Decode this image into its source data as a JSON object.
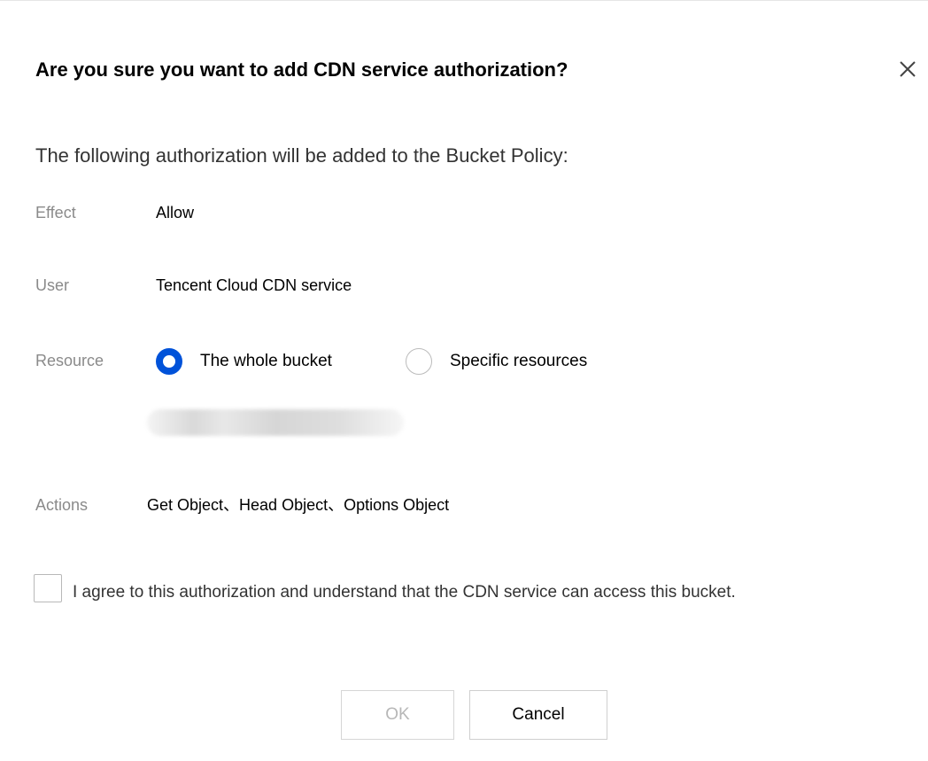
{
  "dialog": {
    "title": "Are you sure you want to add CDN service authorization?",
    "close_icon": "close-icon",
    "intro": "The following authorization will be added to the Bucket Policy:",
    "effect": {
      "label": "Effect",
      "value": "Allow"
    },
    "user": {
      "label": "User",
      "value": "Tencent Cloud CDN service"
    },
    "resource": {
      "label": "Resource",
      "options": [
        {
          "label": "The whole bucket",
          "selected": true
        },
        {
          "label": "Specific resources",
          "selected": false
        }
      ]
    },
    "actions": {
      "label": "Actions",
      "value": "Get Object、Head Object、Options Object"
    },
    "agreement": {
      "text": "I agree to this authorization and understand that the CDN service can access this bucket.",
      "checked": false
    },
    "buttons": {
      "ok": "OK",
      "ok_disabled": true,
      "cancel": "Cancel"
    }
  },
  "colors": {
    "accent": "#0052d9",
    "label_gray": "#8a8a8a",
    "disabled_text": "#b7b7b7",
    "border": "#d6d6d6"
  }
}
